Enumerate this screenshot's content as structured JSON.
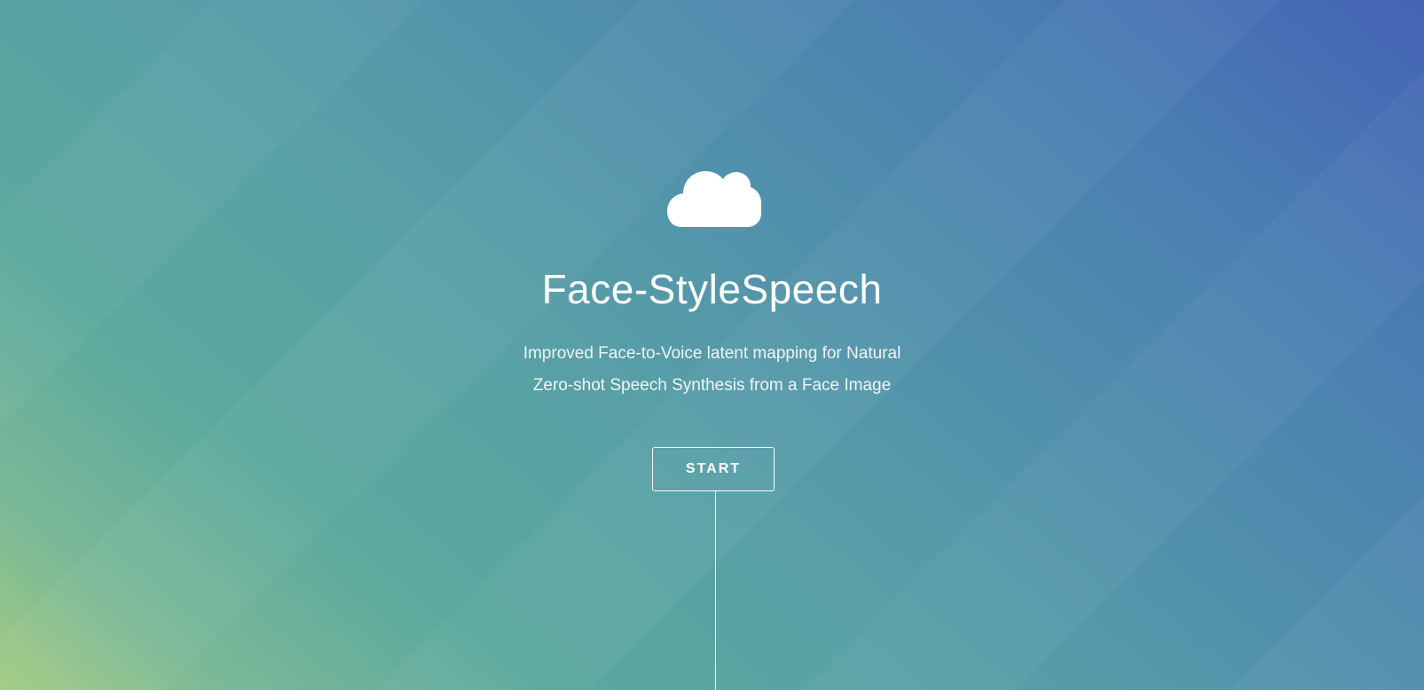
{
  "hero": {
    "icon": "cloud-icon",
    "title": "Face-StyleSpeech",
    "subtitle_line1": "Improved Face-to-Voice latent mapping for Natural",
    "subtitle_line2": "Zero-shot Speech Synthesis from a Face Image",
    "start_label": "START"
  },
  "colors": {
    "gradient_bottom_left": "#a3cb81",
    "gradient_mid": "#589fa7",
    "gradient_top_right": "#4563b5",
    "foreground": "#ffffff"
  }
}
